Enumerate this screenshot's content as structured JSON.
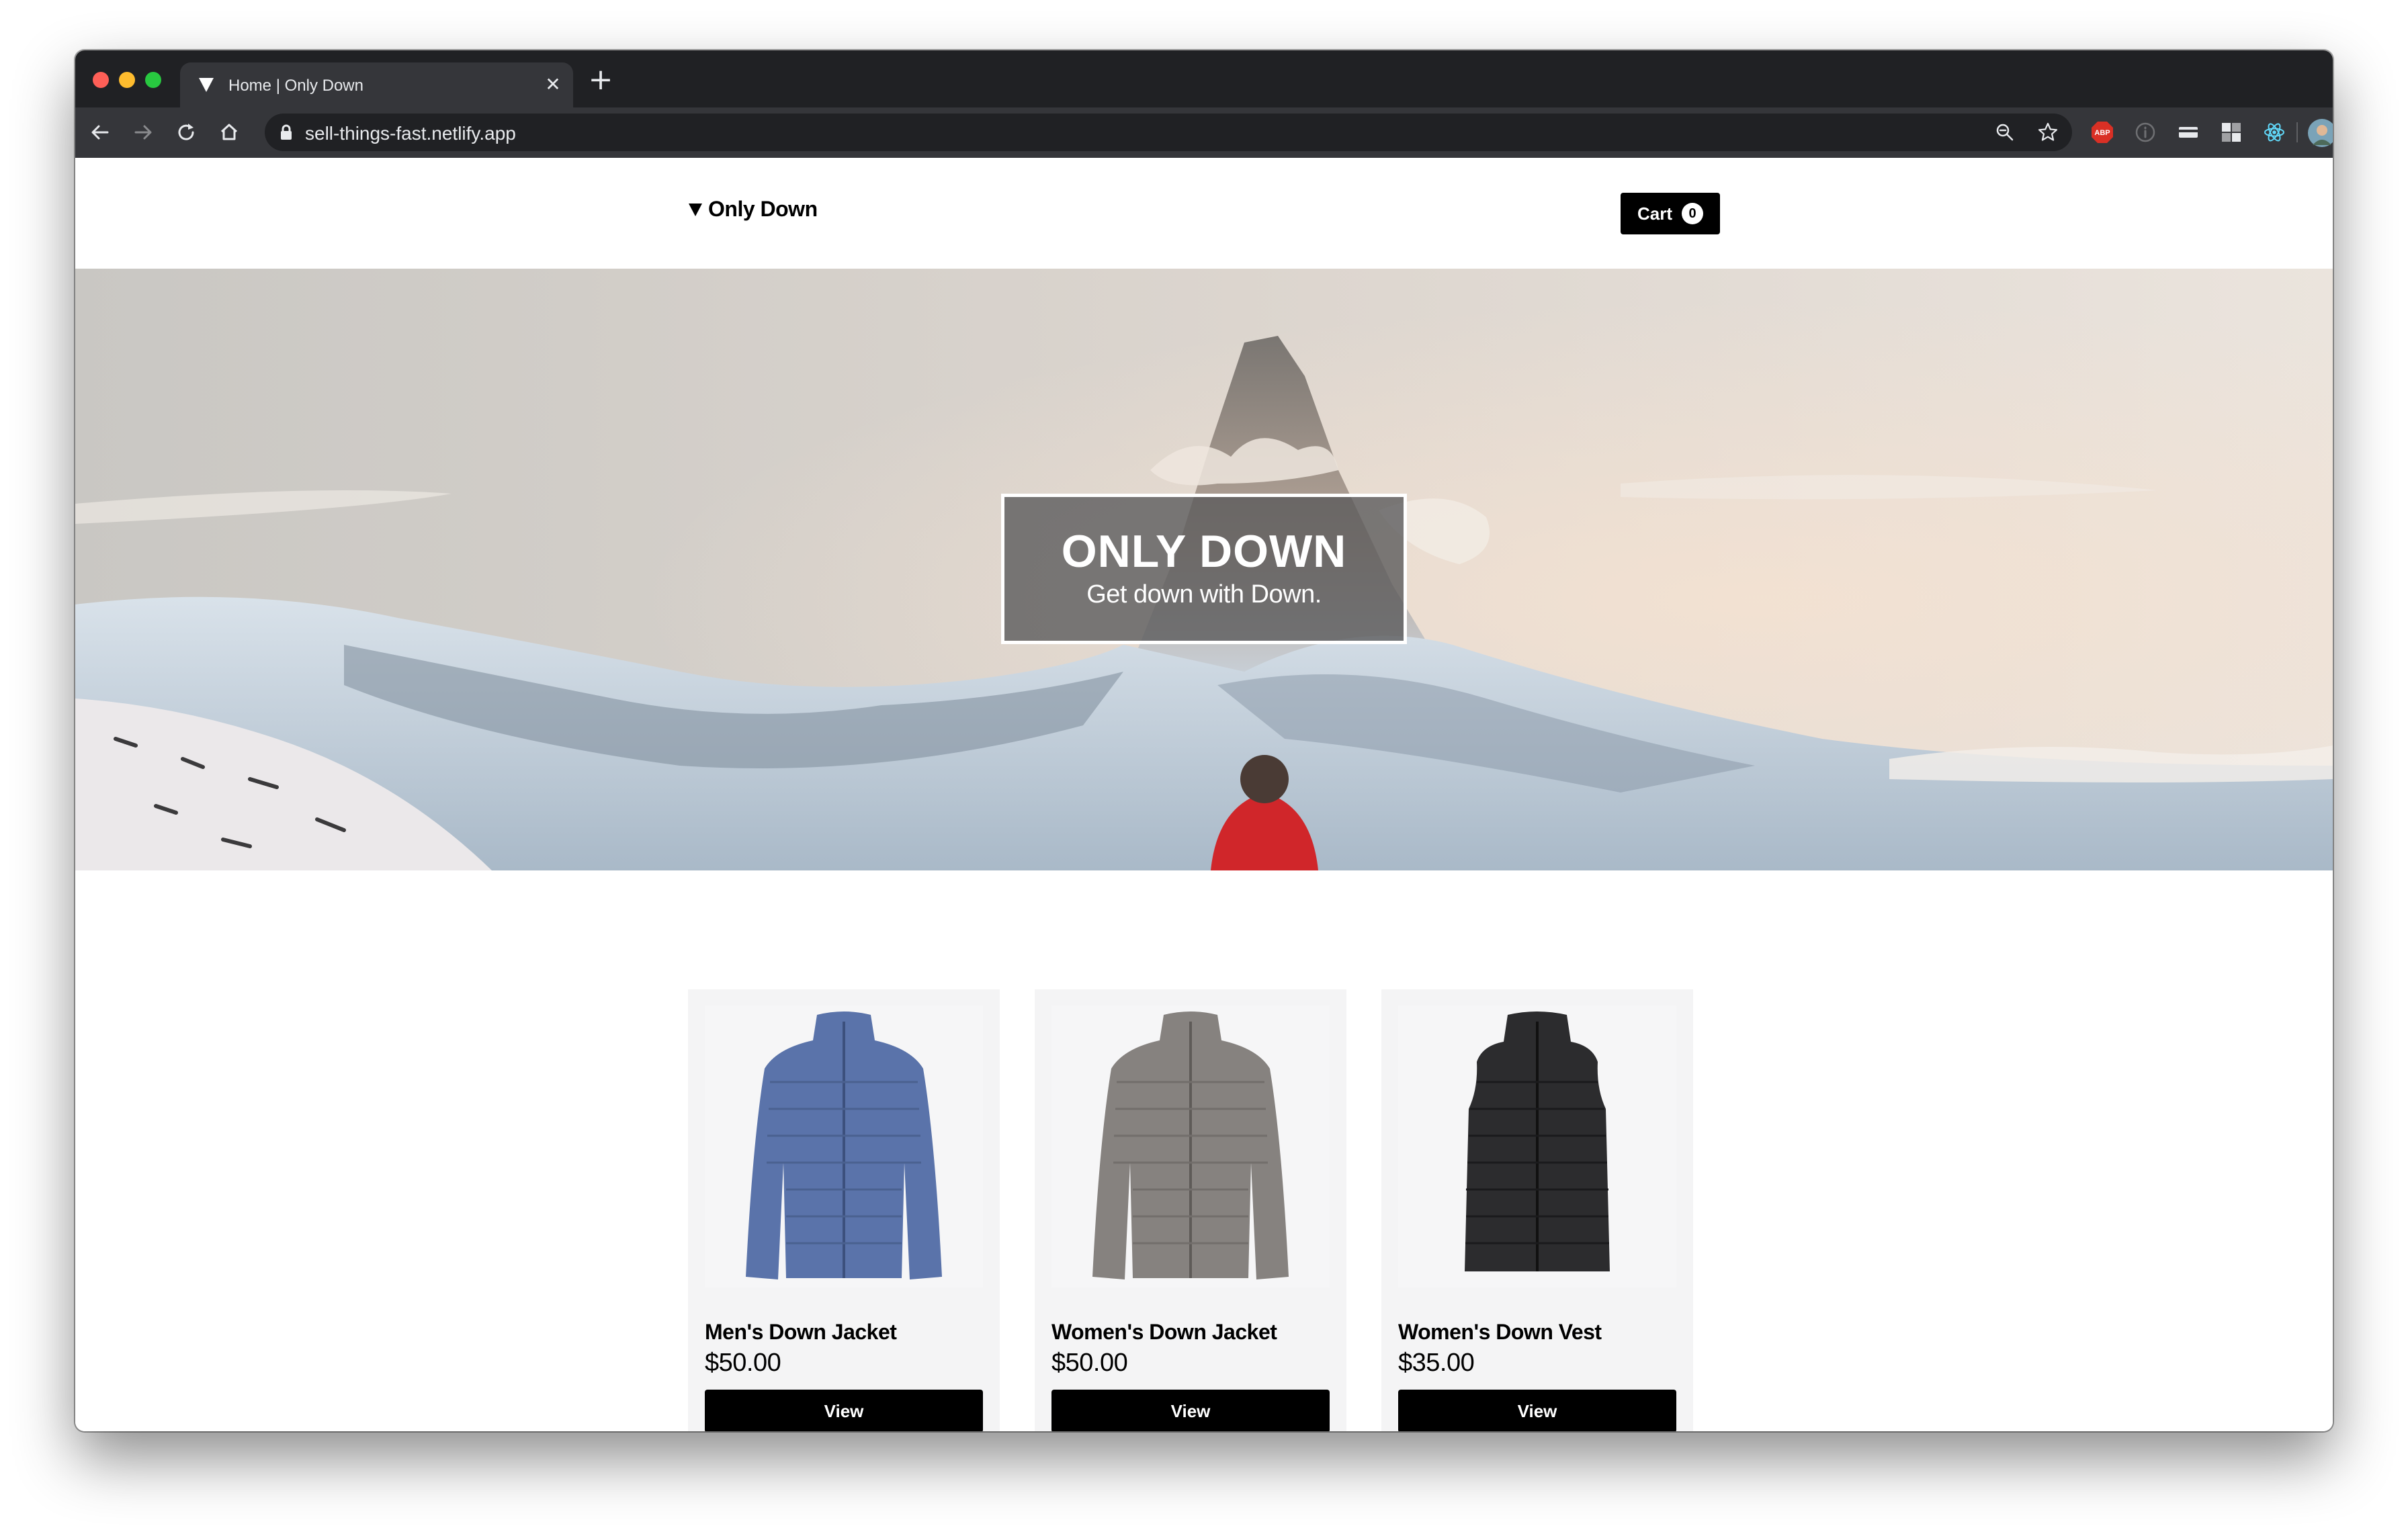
{
  "browser": {
    "tab_title": "Home | Only Down",
    "url": "sell-things-fast.netlify.app",
    "extension_badge": "ABP"
  },
  "header": {
    "brand": "Only Down",
    "cart_label": "Cart",
    "cart_count": "0"
  },
  "hero": {
    "title": "ONLY DOWN",
    "subtitle": "Get down with Down."
  },
  "products": [
    {
      "name": "Men's Down Jacket",
      "price": "$50.00",
      "button": "View",
      "color": "#5a73aa",
      "icon": "blue-jacket"
    },
    {
      "name": "Women's Down Jacket",
      "price": "$50.00",
      "button": "View",
      "color": "#86827f",
      "icon": "grey-jacket"
    },
    {
      "name": "Women's Down Vest",
      "price": "$35.00",
      "button": "View",
      "color": "#2c2c2e",
      "icon": "black-vest"
    }
  ]
}
